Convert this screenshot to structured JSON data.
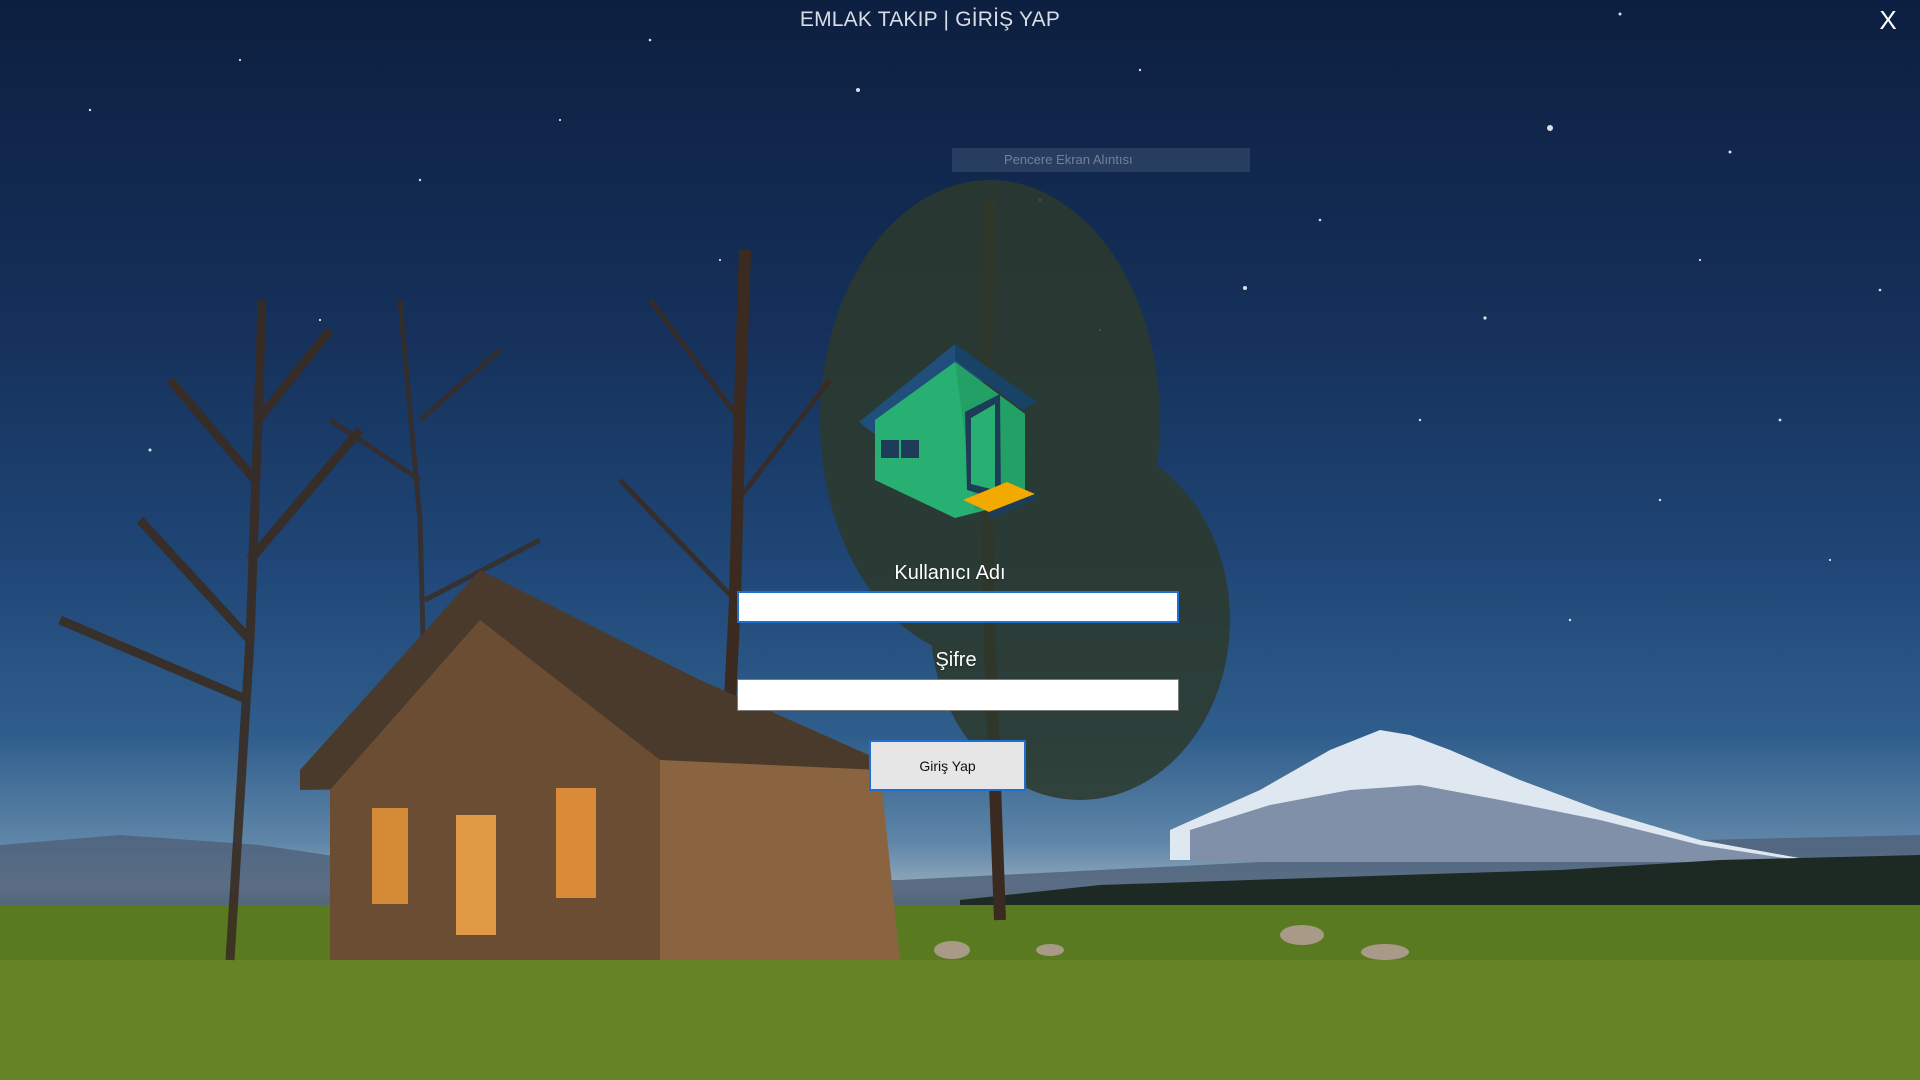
{
  "window": {
    "title": "EMLAK TAKIP | GİRİŞ YAP",
    "close_label": "X"
  },
  "snip_overlay": {
    "text": "Pencere Ekran Alıntısı"
  },
  "login_form": {
    "username_label": "Kullanıcı Adı",
    "username_value": "",
    "password_label": "Şifre",
    "password_value": "",
    "submit_label": "Giriş Yap"
  },
  "colors": {
    "logo_roof": "#1f4f7a",
    "logo_walls": "#27b072",
    "logo_door_step": "#f2a900",
    "focus_border": "#1f6fd0"
  },
  "icons": {
    "logo": "house-logo-icon",
    "close": "close-icon"
  }
}
